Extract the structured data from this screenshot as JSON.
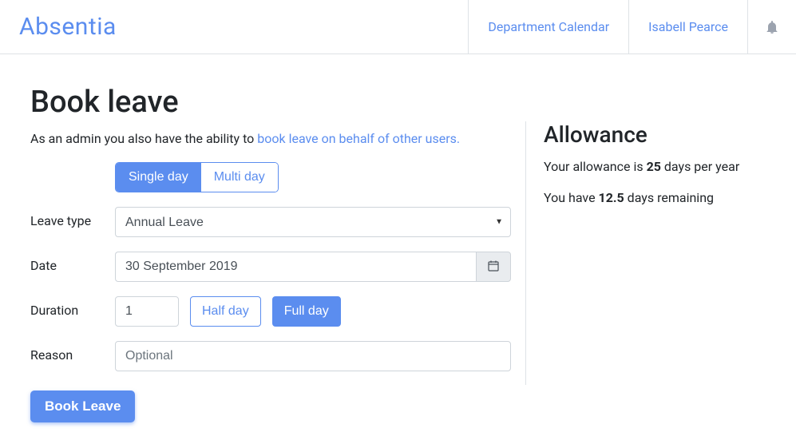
{
  "brand": "Absentia",
  "nav": {
    "calendar": "Department Calendar",
    "user": "Isabell Pearce"
  },
  "page": {
    "title": "Book leave",
    "subtitle_prefix": "As an admin you also have the ability to ",
    "subtitle_link": "book leave on behalf of other users.",
    "tabs": {
      "single": "Single day",
      "multi": "Multi day"
    },
    "labels": {
      "leave_type": "Leave type",
      "date": "Date",
      "duration": "Duration",
      "reason": "Reason"
    },
    "leave_type_value": "Annual Leave",
    "date_value": "30 September 2019",
    "duration_value": "1",
    "duration_buttons": {
      "half": "Half day",
      "full": "Full day"
    },
    "reason_placeholder": "Optional",
    "submit": "Book Leave"
  },
  "allowance": {
    "title": "Allowance",
    "line1_prefix": "Your allowance is ",
    "line1_value": "25",
    "line1_suffix": " days per year",
    "line2_prefix": "You have ",
    "line2_value": "12.5",
    "line2_suffix": " days remaining"
  }
}
